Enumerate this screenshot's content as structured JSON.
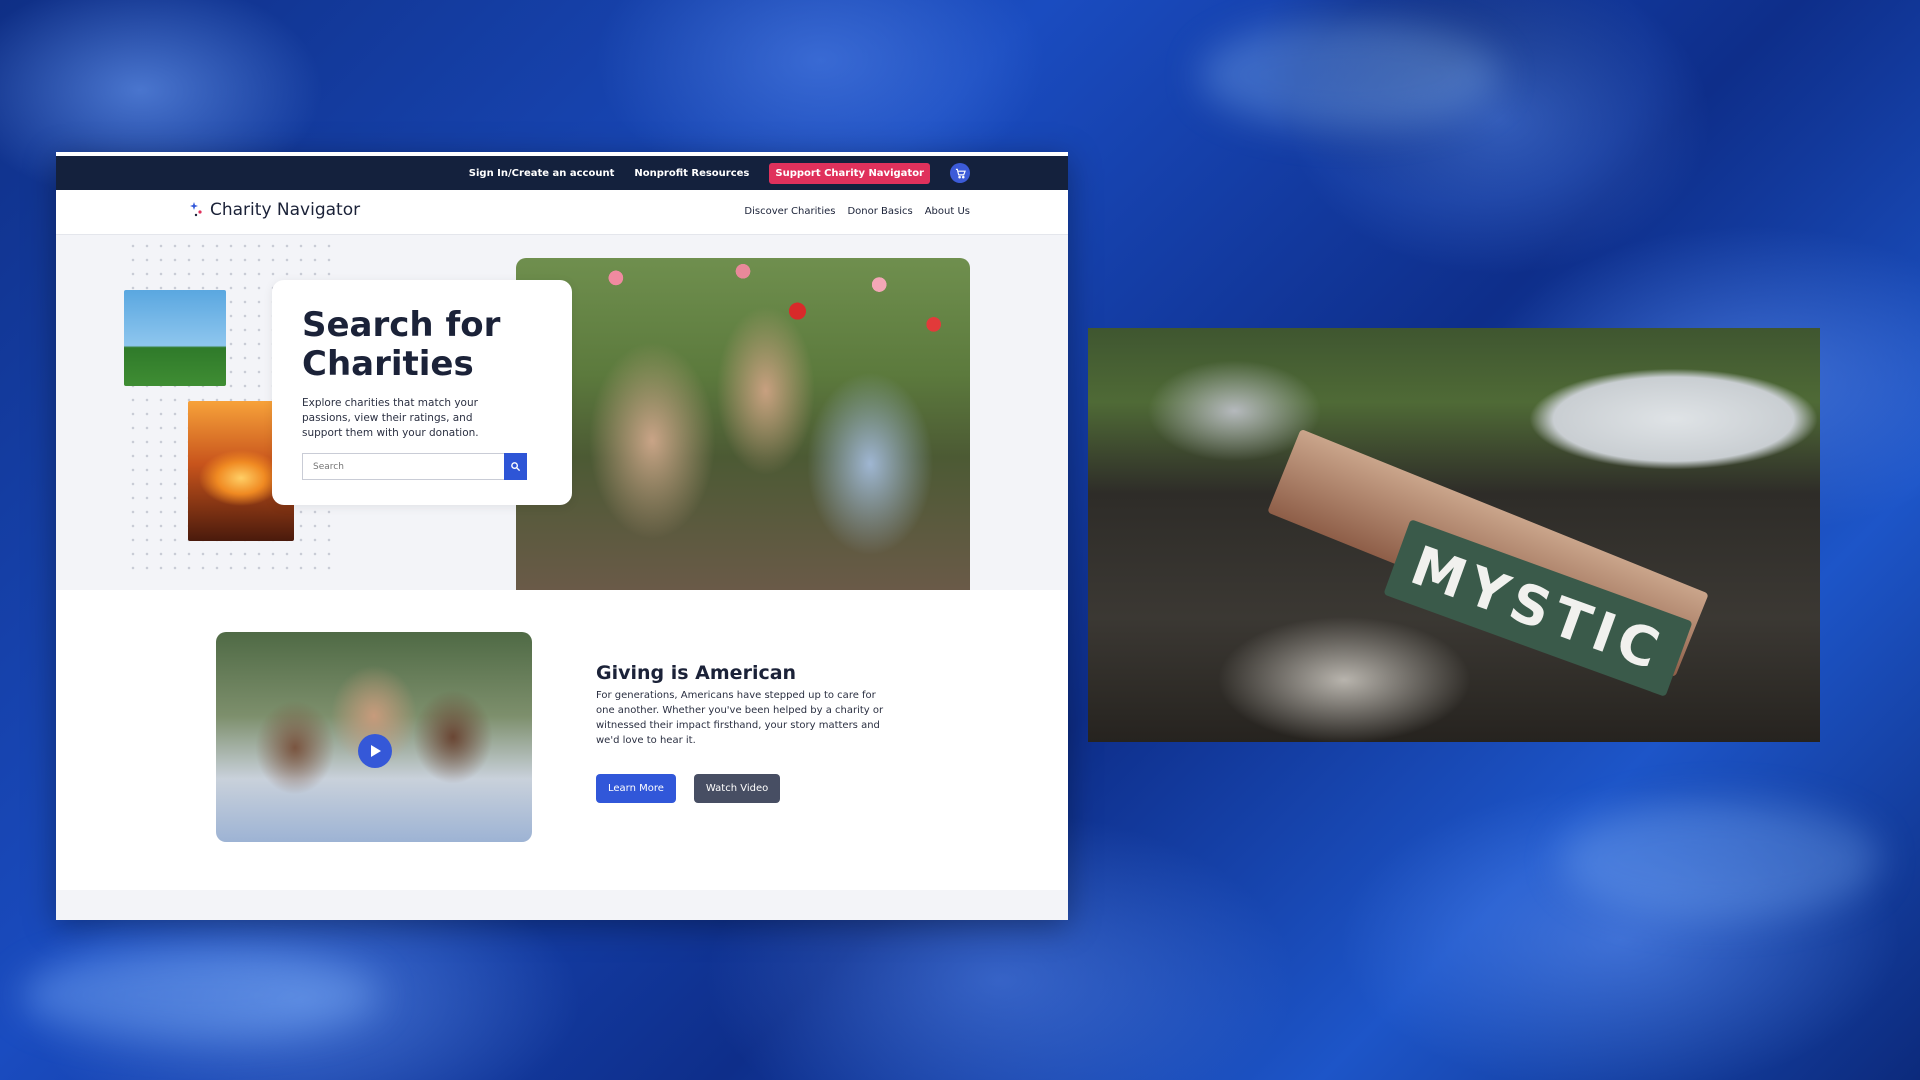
{
  "site": {
    "topbar": {
      "sign_in": "Sign In/Create an account",
      "nonprofit_resources": "Nonprofit Resources",
      "support": "Support Charity Navigator"
    },
    "brand": "Charity Navigator",
    "nav": {
      "discover": "Discover Charities",
      "donor_basics": "Donor Basics",
      "about": "About Us"
    },
    "hero": {
      "title": "Search for Charities",
      "description": "Explore charities that match your passions, view their ratings, and support them with your donation.",
      "search_placeholder": "Search"
    },
    "giving": {
      "title": "Giving is American",
      "body": "For generations, Americans have stepped up to care for one another. Whether you've been helped by a charity or witnessed their impact firsthand, your story matters and we'd love to hear it.",
      "learn_more": "Learn More",
      "watch_video": "Watch Video"
    }
  },
  "photo": {
    "sign_text": "MYSTIC"
  },
  "colors": {
    "topbar_bg": "#14213d",
    "support_red": "#e0315c",
    "brand_blue": "#3157d9",
    "background_blue": "#1a4cc0"
  }
}
